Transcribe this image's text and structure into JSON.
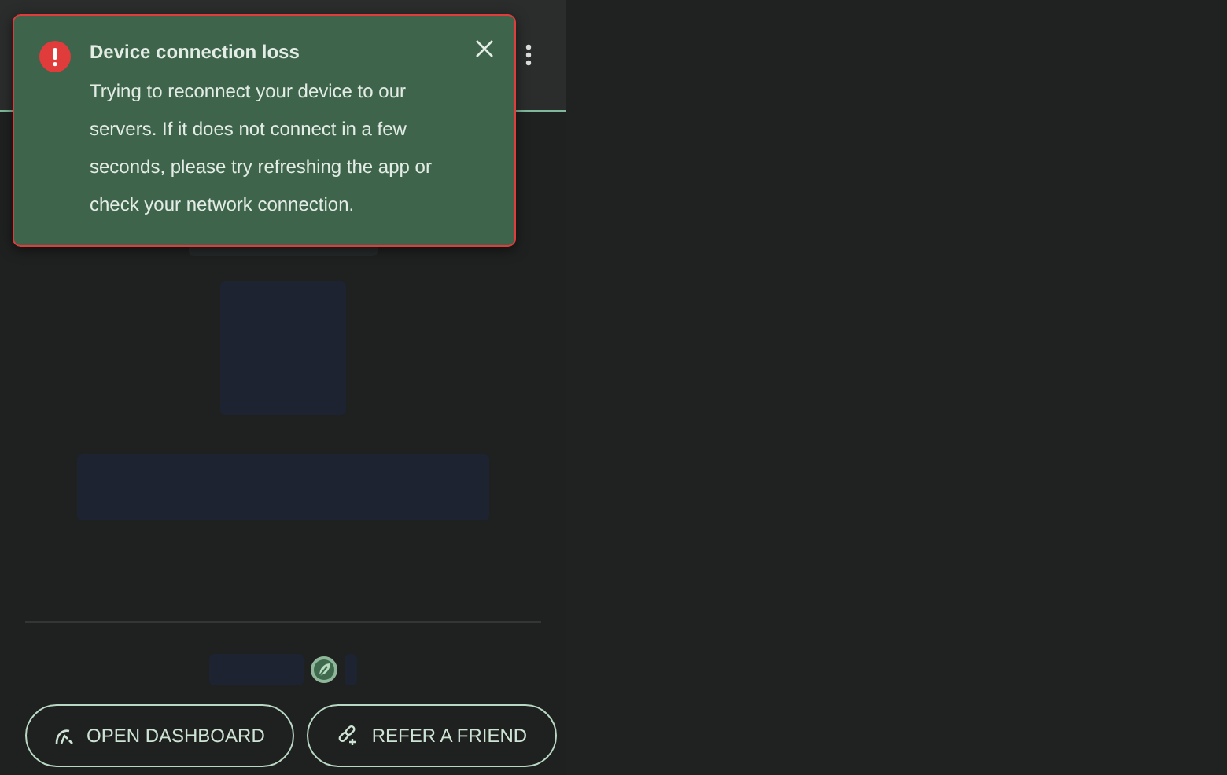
{
  "toast": {
    "kind": "error",
    "title": "Device connection loss",
    "message": "Trying to reconnect your device to our servers. If it does not connect in a few seconds, please try refreshing the app or check your network connection."
  },
  "buttons": [
    {
      "label": "OPEN DASHBOARD",
      "kind": "dashboard"
    },
    {
      "label": "REFER A FRIEND",
      "kind": "refer"
    }
  ]
}
